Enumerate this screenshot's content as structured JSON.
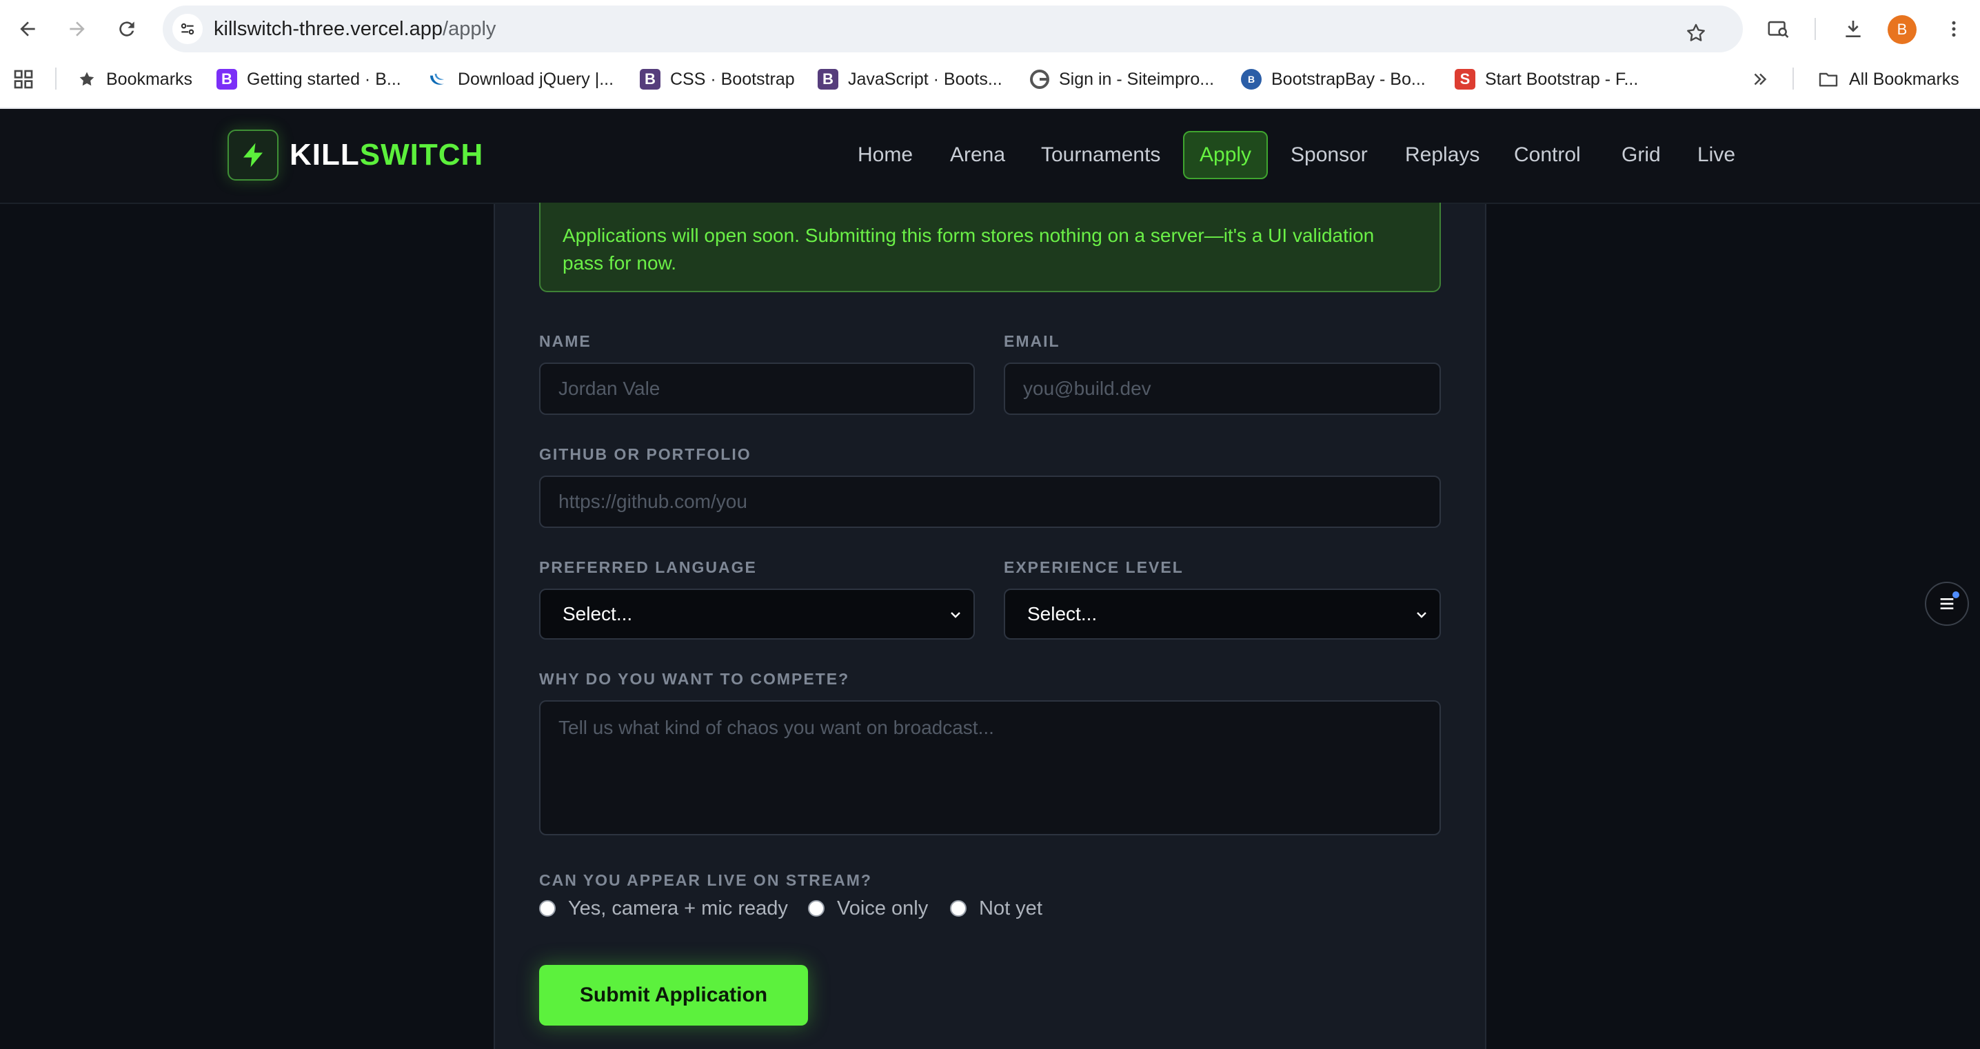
{
  "browser": {
    "url_host": "killswitch-three.vercel.app",
    "url_path": "/apply",
    "profile_initial": "B",
    "bookmarks": [
      {
        "label": "Bookmarks",
        "icon": "star-icon"
      },
      {
        "label": "Getting started · B...",
        "icon": "bootstrap-icon",
        "color": "#7b2ff7"
      },
      {
        "label": "Download jQuery |...",
        "icon": "jquery-icon",
        "color": "#0f6cb6"
      },
      {
        "label": "CSS · Bootstrap",
        "icon": "bootstrap-icon",
        "color": "#563d7c"
      },
      {
        "label": "JavaScript · Boots...",
        "icon": "bootstrap-icon",
        "color": "#563d7c"
      },
      {
        "label": "Sign in - Siteimpro...",
        "icon": "siteimprove-icon",
        "color": "#555555"
      },
      {
        "label": "BootstrapBay - Bo...",
        "icon": "bootstrapbay-icon",
        "color": "#2b5ea7"
      },
      {
        "label": "Start Bootstrap - F...",
        "icon": "startbootstrap-icon",
        "color": "#dd3d31"
      }
    ],
    "all_bookmarks_label": "All Bookmarks"
  },
  "site": {
    "logo_part1": "KILL",
    "logo_part2": "SWITCH",
    "nav": [
      {
        "label": "Home",
        "active": false
      },
      {
        "label": "Arena",
        "active": false
      },
      {
        "label": "Tournaments",
        "active": false
      },
      {
        "label": "Apply",
        "active": true
      },
      {
        "label": "Sponsor",
        "active": false
      },
      {
        "label": "Replays",
        "active": false
      },
      {
        "label": "Control",
        "active": false
      },
      {
        "label": "Grid",
        "active": false
      },
      {
        "label": "Live",
        "active": false
      }
    ],
    "accent_color": "#5cf03c"
  },
  "form": {
    "notice": "Applications will open soon. Submitting this form stores nothing on a server—it's a UI validation pass for now.",
    "name_label": "NAME",
    "name_placeholder": "Jordan Vale",
    "email_label": "EMAIL",
    "email_placeholder": "you@build.dev",
    "github_label": "GITHUB OR PORTFOLIO",
    "github_placeholder": "https://github.com/you",
    "language_label": "PREFERRED LANGUAGE",
    "language_value": "Select...",
    "experience_label": "EXPERIENCE LEVEL",
    "experience_value": "Select...",
    "why_label": "WHY DO YOU WANT TO COMPETE?",
    "why_placeholder": "Tell us what kind of chaos you want on broadcast...",
    "stream_label": "CAN YOU APPEAR LIVE ON STREAM?",
    "stream_options": [
      "Yes, camera + mic ready",
      "Voice only",
      "Not yet"
    ],
    "submit_label": "Submit Application"
  }
}
